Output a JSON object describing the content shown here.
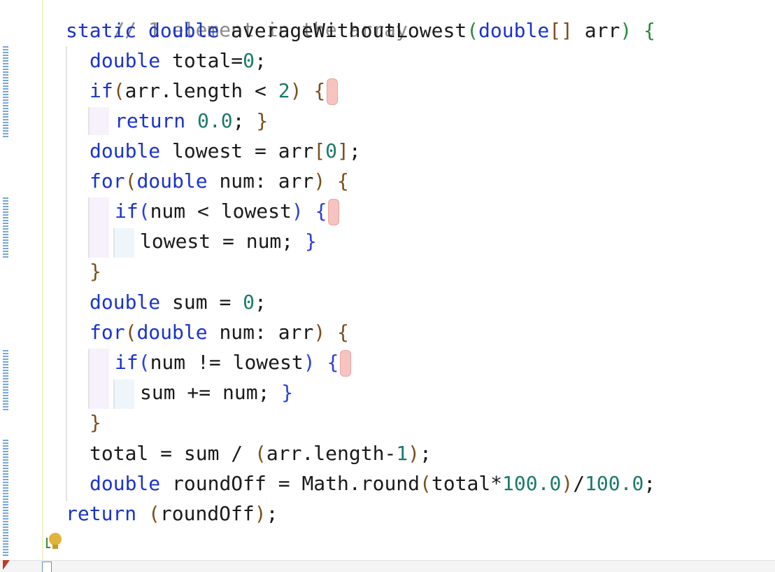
{
  "comment_partial": "// 1 element in the array",
  "code": {
    "sig_static": "static",
    "sig_double": "double",
    "sig_name": "averageWithoutLowest",
    "sig_param_type": "double",
    "sig_brackets": "[]",
    "sig_param": "arr",
    "l1_kw": "double",
    "l1_rest": "total=",
    "l1_num": "0",
    "l2_kw": "if",
    "l2_rest": "arr.length < ",
    "l2_num": "2",
    "l3_kw": "return",
    "l3_num": "0.0",
    "l4_kw": "double",
    "l4_rest": "lowest = arr",
    "l4_num": "0",
    "l5_kw1": "for",
    "l5_kw2": "double",
    "l5_rest": "num: arr",
    "l6_kw": "if",
    "l6_rest": "num < lowest",
    "l7_rest": "lowest = num; ",
    "l9_kw": "double",
    "l9_rest": "sum = ",
    "l9_num": "0",
    "l10_kw1": "for",
    "l10_kw2": "double",
    "l10_rest": "num: arr",
    "l11_kw": "if",
    "l11_rest": "num != lowest",
    "l12_rest": "sum += num; ",
    "l14_rest1": "total = sum / ",
    "l14_rest2": "arr.length-",
    "l14_num": "1",
    "l15_kw": "double",
    "l15_rest1": "roundOff = Math.round",
    "l15_rest2": "total*",
    "l15_num1": "100.0",
    "l15_num2": "100.0",
    "l16_kw": "return",
    "l16_rest": "roundOff"
  },
  "colors": {
    "keyword": "#1a33cc",
    "number": "#1b7a6a",
    "paren": "#7a4f1e",
    "bulb": "#e0b43a"
  },
  "icons": [
    "lightbulb-icon",
    "fold-icon"
  ]
}
